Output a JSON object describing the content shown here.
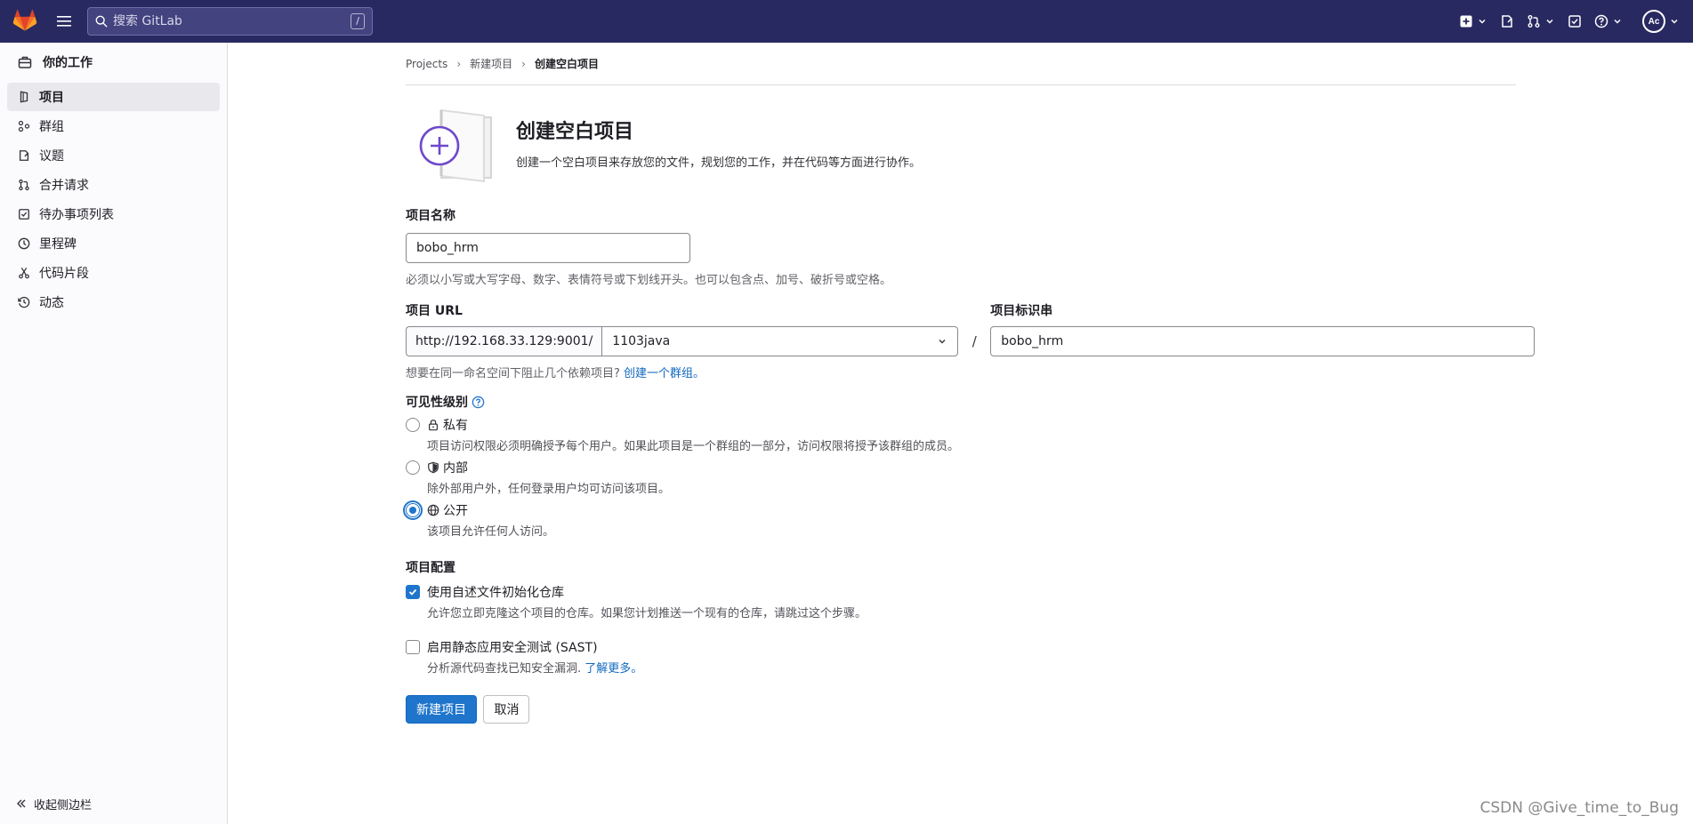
{
  "search": {
    "placeholder": "搜索 GitLab",
    "shortcut": "/"
  },
  "user": {
    "initials": "Ac"
  },
  "sidebar": {
    "context": "你的工作",
    "items": [
      {
        "label": "项目",
        "icon": "project-icon",
        "active": true
      },
      {
        "label": "群组",
        "icon": "group-icon"
      },
      {
        "label": "议题",
        "icon": "issues-icon"
      },
      {
        "label": "合并请求",
        "icon": "merge-request-icon"
      },
      {
        "label": "待办事项列表",
        "icon": "todo-icon"
      },
      {
        "label": "里程碑",
        "icon": "milestone-icon"
      },
      {
        "label": "代码片段",
        "icon": "snippet-icon"
      },
      {
        "label": "动态",
        "icon": "activity-icon"
      }
    ],
    "collapse_label": "收起侧边栏"
  },
  "breadcrumb": {
    "items": [
      "Projects",
      "新建项目"
    ],
    "current": "创建空白项目"
  },
  "hero": {
    "title": "创建空白项目",
    "subtitle": "创建一个空白项目来存放您的文件，规划您的工作，并在代码等方面进行协作。"
  },
  "form": {
    "name_label": "项目名称",
    "name_value": "bobo_hrm",
    "name_help": "必须以小写或大写字母、数字、表情符号或下划线开头。也可以包含点、加号、破折号或空格。",
    "url_label": "项目 URL",
    "url_prefix": "http://192.168.33.129:9001/",
    "url_namespace": "1103java",
    "url_slash": "/",
    "slug_label": "项目标识串",
    "slug_value": "bobo_hrm",
    "group_help": "想要在同一命名空间下阻止几个依赖项目?",
    "group_link": "创建一个群组。",
    "visibility_label": "可见性级别",
    "visibility": [
      {
        "label": "私有",
        "help": "项目访问权限必须明确授予每个用户。如果此项目是一个群组的一部分，访问权限将授予该群组的成员。",
        "checked": false
      },
      {
        "label": "内部",
        "help": "除外部用户外，任何登录用户均可访问该项目。",
        "checked": false
      },
      {
        "label": "公开",
        "help": "该项目允许任何人访问。",
        "checked": true
      }
    ],
    "config_label": "项目配置",
    "readme_label": "使用自述文件初始化仓库",
    "readme_help": "允许您立即克隆这个项目的仓库。如果您计划推送一个现有的仓库，请跳过这个步骤。",
    "readme_checked": true,
    "sast_label": "启用静态应用安全测试 (SAST)",
    "sast_help": "分析源代码查找已知安全漏洞.",
    "sast_link": "了解更多。",
    "sast_checked": false,
    "submit_label": "新建项目",
    "cancel_label": "取消"
  },
  "watermark": "CSDN @Give_time_to_Bug",
  "colors": {
    "topbar": "#292961",
    "primary": "#1f75cb",
    "link": "#1068bf",
    "illustration": "#6e49cb"
  }
}
